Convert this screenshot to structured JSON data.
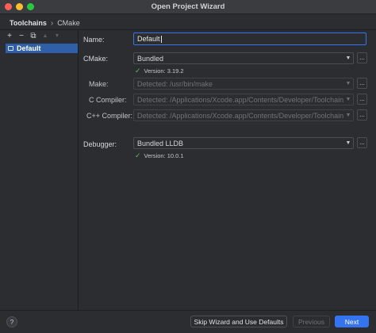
{
  "window": {
    "title": "Open Project Wizard"
  },
  "breadcrumb": {
    "section": "Toolchains",
    "separator": "›",
    "current": "CMake"
  },
  "sidebar": {
    "toolbar": {
      "add": "+",
      "remove": "−",
      "copy": "⧉",
      "up": "▲",
      "down": "▼"
    },
    "items": [
      {
        "label": "Default",
        "selected": true
      }
    ]
  },
  "form": {
    "name": {
      "label": "Name:",
      "value": "Default"
    },
    "cmake": {
      "label": "CMake:",
      "value": "Bundled",
      "version": "Version: 3.19.2"
    },
    "make": {
      "label": "Make:",
      "placeholder": "Detected: /usr/bin/make"
    },
    "c_compiler": {
      "label": "C Compiler:",
      "placeholder": "Detected: /Applications/Xcode.app/Contents/Developer/Toolchains/Xcod"
    },
    "cpp_compiler": {
      "label": "C++ Compiler:",
      "placeholder": "Detected: /Applications/Xcode.app/Contents/Developer/Toolchains/Xcod"
    },
    "debugger": {
      "label": "Debugger:",
      "value": "Bundled LLDB",
      "version": "Version: 10.0.1"
    },
    "browse_label": "..."
  },
  "footer": {
    "help": "?",
    "skip_label": "Skip Wizard and Use Defaults",
    "previous_label": "Previous",
    "next_label": "Next"
  },
  "colors": {
    "accent": "#3574f0",
    "selection": "#2e5fa8",
    "success": "#5fb865"
  }
}
